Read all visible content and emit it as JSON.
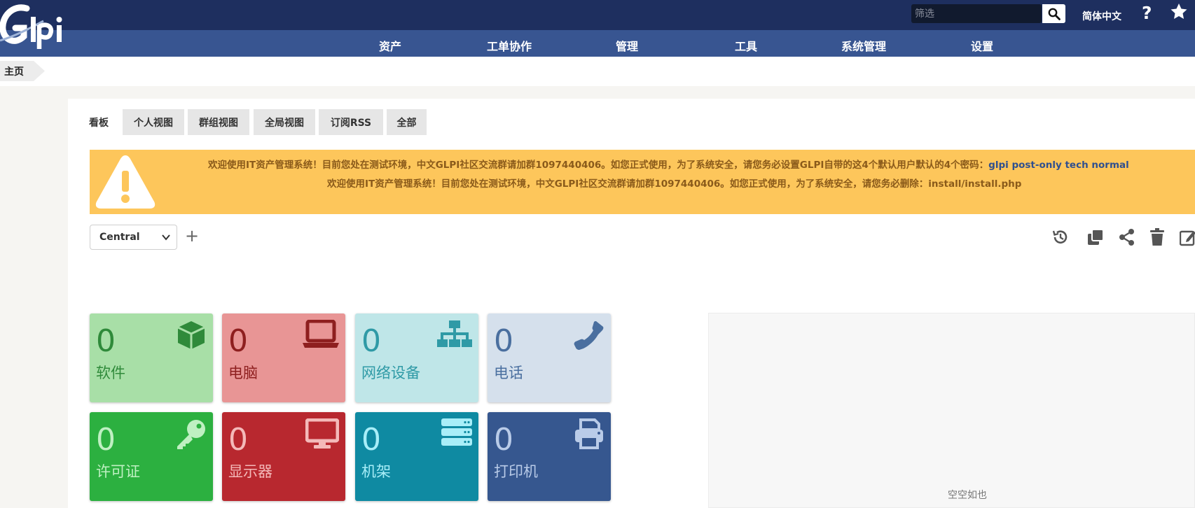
{
  "header": {
    "logo_text": "Glpi",
    "search_placeholder": "筛选",
    "language": "简体中文",
    "help_glyph": "?"
  },
  "nav": {
    "items": [
      {
        "label": "资产"
      },
      {
        "label": "工单协作"
      },
      {
        "label": "管理"
      },
      {
        "label": "工具"
      },
      {
        "label": "系统管理"
      },
      {
        "label": "设置"
      }
    ]
  },
  "breadcrumb": {
    "home": "主页"
  },
  "tabs": [
    {
      "label": "看板",
      "active": true
    },
    {
      "label": "个人视图"
    },
    {
      "label": "群组视图"
    },
    {
      "label": "全局视图"
    },
    {
      "label": "订阅RSS"
    },
    {
      "label": "全部"
    }
  ],
  "alert": {
    "line1_text": "欢迎使用IT资产管理系统！目前您处在测试环境，中文GLPI社区交流群请加群1097440406。如您正式使用，为了系统安全，请您务必设置GLPI自带的这4个默认用户默认的4个密码：",
    "line1_highlight": "glpi post-only tech normal",
    "line2_text": "欢迎使用IT资产管理系统！目前您处在测试环境，中文GLPI社区交流群请加群1097440406。如您正式使用，为了系统安全，请您务必删除：install/install.php"
  },
  "dashboard": {
    "selected": "Central",
    "add_glyph": "+",
    "empty_text": "空空如也"
  },
  "cards": [
    {
      "count": "0",
      "label": "软件",
      "icon": "cube-icon",
      "bg": "#a8dfa7",
      "fg": "#2f8a3a"
    },
    {
      "count": "0",
      "label": "电脑",
      "icon": "laptop-icon",
      "bg": "#e89595",
      "fg": "#8e1f1f"
    },
    {
      "count": "0",
      "label": "网络设备",
      "icon": "network-icon",
      "bg": "#bfe6e8",
      "fg": "#2f9aa6"
    },
    {
      "count": "0",
      "label": "电话",
      "icon": "phone-icon",
      "bg": "#d5e0ec",
      "fg": "#4a6f9f"
    },
    {
      "count": "0",
      "label": "许可证",
      "icon": "key-icon",
      "bg": "#2cb040",
      "fg": "#bff0c2"
    },
    {
      "count": "0",
      "label": "显示器",
      "icon": "monitor-icon",
      "bg": "#b8282f",
      "fg": "#f4b9b9"
    },
    {
      "count": "0",
      "label": "机架",
      "icon": "server-icon",
      "bg": "#0f8aa2",
      "fg": "#a8eef8"
    },
    {
      "count": "0",
      "label": "打印机",
      "icon": "printer-icon",
      "bg": "#36578f",
      "fg": "#b9cbe8"
    }
  ]
}
